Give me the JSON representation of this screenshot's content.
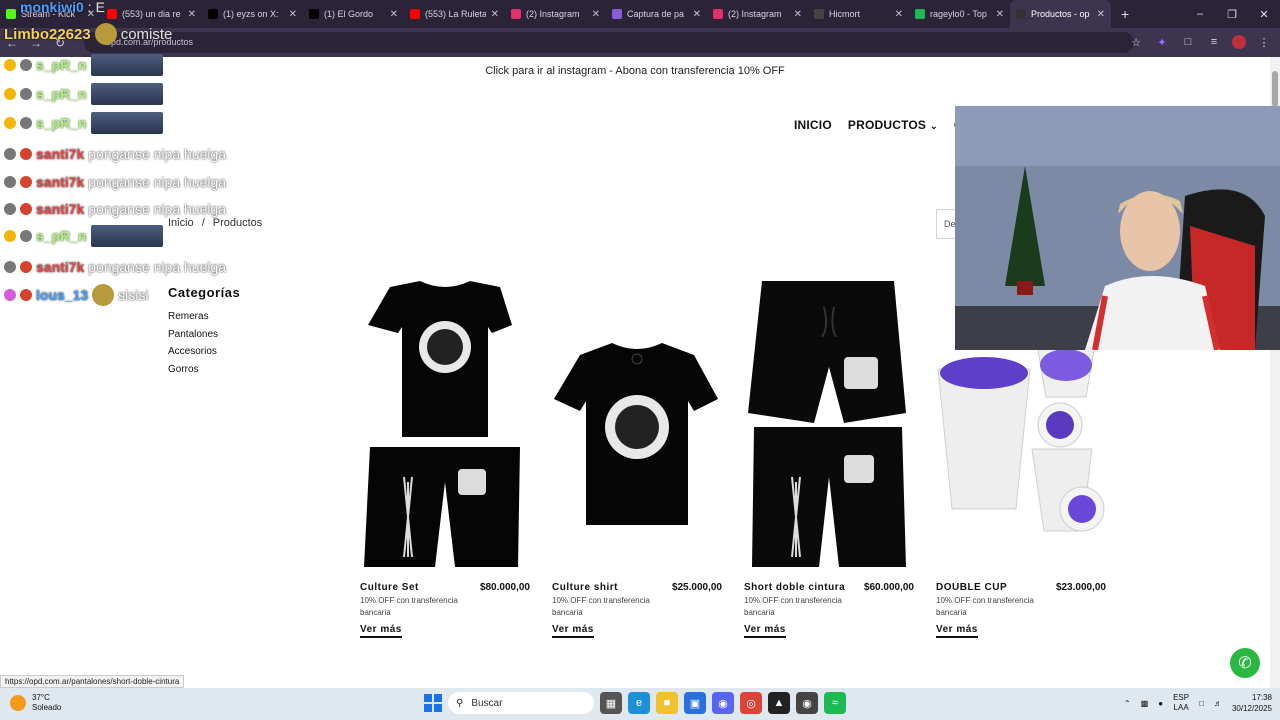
{
  "browser": {
    "tabs": [
      {
        "label": "Stream - Kick",
        "color": "#53fc18"
      },
      {
        "label": "(553) un dia re",
        "color": "#ff0000"
      },
      {
        "label": "(1) eyzs on X:",
        "color": "#000000"
      },
      {
        "label": "(1) El Gordo",
        "color": "#000000"
      },
      {
        "label": "(553) La Ruleta",
        "color": "#ff0000"
      },
      {
        "label": "(2) Instagram",
        "color": "#e1306c"
      },
      {
        "label": "Captura de pa",
        "color": "#8a5cd6"
      },
      {
        "label": "(2) Instagram",
        "color": "#e1306c"
      },
      {
        "label": "Hicmort",
        "color": "#444444"
      },
      {
        "label": "rageylo0 - Top",
        "color": "#1db954"
      },
      {
        "label": "Productos - op",
        "color": "#333333"
      }
    ],
    "new_tab": "+",
    "url": "opd.com.ar/productos"
  },
  "page": {
    "announcement": "Click para ir al instagram - Abona con transferencia 10% OFF",
    "nav": {
      "inicio": "INICIO",
      "productos": "PRODUCTOS",
      "contacto": "CO"
    },
    "breadcrumb": {
      "home": "Inicio",
      "sep": "/",
      "current": "Productos"
    },
    "sort_partial": "De",
    "categories_title": "Categorías",
    "categories": [
      "Remeras",
      "Pantalones",
      "Accesorios",
      "Gorros"
    ],
    "products": [
      {
        "name": "Culture Set",
        "price": "$80.000,00",
        "note": "10% OFF con transferencia bancaria",
        "cta": "Ver más"
      },
      {
        "name": "Culture shirt",
        "price": "$25.000,00",
        "note": "10% OFF con transferencia bancaria",
        "cta": "Ver más"
      },
      {
        "name": "Short doble cintura",
        "price": "$60.000,00",
        "note": "10% OFF con transferencia bancaria",
        "cta": "Ver más"
      },
      {
        "name": "DOUBLE CUP",
        "price": "$23.000,00",
        "note": "10% OFF con transferencia bancaria",
        "cta": "Ver más"
      }
    ]
  },
  "status_url": "https://opd.com.ar/pantalones/short-doble-cintura",
  "taskbar": {
    "weather_temp": "37°C",
    "weather_desc": "Soleado",
    "search_placeholder": "Buscar",
    "lang_top": "ESP",
    "lang_bottom": "LAA",
    "time": "17:38",
    "date": "30/12/2025"
  },
  "stream_overlay": {
    "top_user": "monkiwi0",
    "top_text": ": E",
    "line2_user": "Limbo22623",
    "line2_text": "comiste",
    "chat": [
      {
        "user": "s_pR_n",
        "msg": ""
      },
      {
        "user": "s_pR_n",
        "msg": ""
      },
      {
        "user": "s_pR_n",
        "msg": ""
      },
      {
        "user": "santi7k",
        "msg": "ponganse nipa huelga"
      },
      {
        "user": "santi7k",
        "msg": "ponganse nipa huelga"
      },
      {
        "user": "santi7k",
        "msg": "ponganse nipa huelga"
      },
      {
        "user": "s_pR_n",
        "msg": ""
      },
      {
        "user": "santi7k",
        "msg": "ponganse nipa huelga"
      },
      {
        "user": "lous_13",
        "msg": "sisisi"
      }
    ]
  }
}
